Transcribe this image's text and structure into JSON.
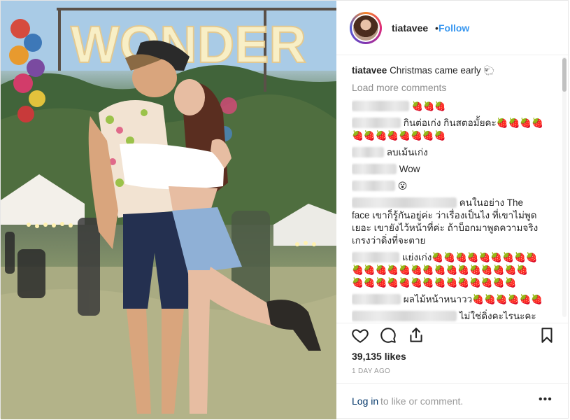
{
  "header": {
    "username": "tiatavee",
    "separator": "•",
    "follow_label": "Follow"
  },
  "caption": {
    "username": "tiatavee",
    "text": "Christmas came early",
    "emoji": "🐑"
  },
  "load_more_label": "Load more comments",
  "comments": [
    {
      "text": "🍓🍓🍓"
    },
    {
      "text": "กินต่อเก่ง กินสตอมั้ยคะ🍓🍓🍓🍓",
      "text2": "🍓🍓🍓🍓🍓🍓🍓🍓"
    },
    {
      "text": "ลบเม้นเก่ง"
    },
    {
      "text": "Wow"
    },
    {
      "text": "😮"
    },
    {
      "text": "คนในอย่าง The",
      "text2": "face เขาก็รู้กันอยู่ค่ะ ว่าเรื่องเป็นไง ที่เขาไม่พูด",
      "text3": "เยอะ เขายังไว้หน้าที่ค่ะ ถ้าบ็อกมาพูดความจริง",
      "text4": "เกรงว่าดิ่งที่จะตาย"
    },
    {
      "text": "แย่งเก่ง🍓🍓🍓🍓🍓🍓🍓🍓🍓",
      "text2": "🍓🍓🍓🍓🍓🍓🍓🍓🍓🍓🍓🍓🍓🍓🍓",
      "text3": "🍓🍓🍓🍓🍓🍓🍓🍓🍓🍓🍓🍓🍓🍓"
    },
    {
      "text": "ผลไม้หน้าหนาวว🍓🍓🍓🍓🍓🍓"
    },
    {
      "text": "ไม่ใช่ดิ่งคะไรนะคะ"
    }
  ],
  "likes": "39,135 likes",
  "timestamp": "1 DAY AGO",
  "login": {
    "link_label": "Log in",
    "rest_text": "to like or comment."
  },
  "more_label": "•••",
  "photo": {
    "sign_text": "WONDER"
  },
  "icons": [
    "heart-icon",
    "comment-icon",
    "share-icon",
    "bookmark-icon",
    "more-options-icon"
  ],
  "colors": {
    "follow": "#3897f0",
    "login_link": "#003569",
    "muted": "#999999"
  }
}
